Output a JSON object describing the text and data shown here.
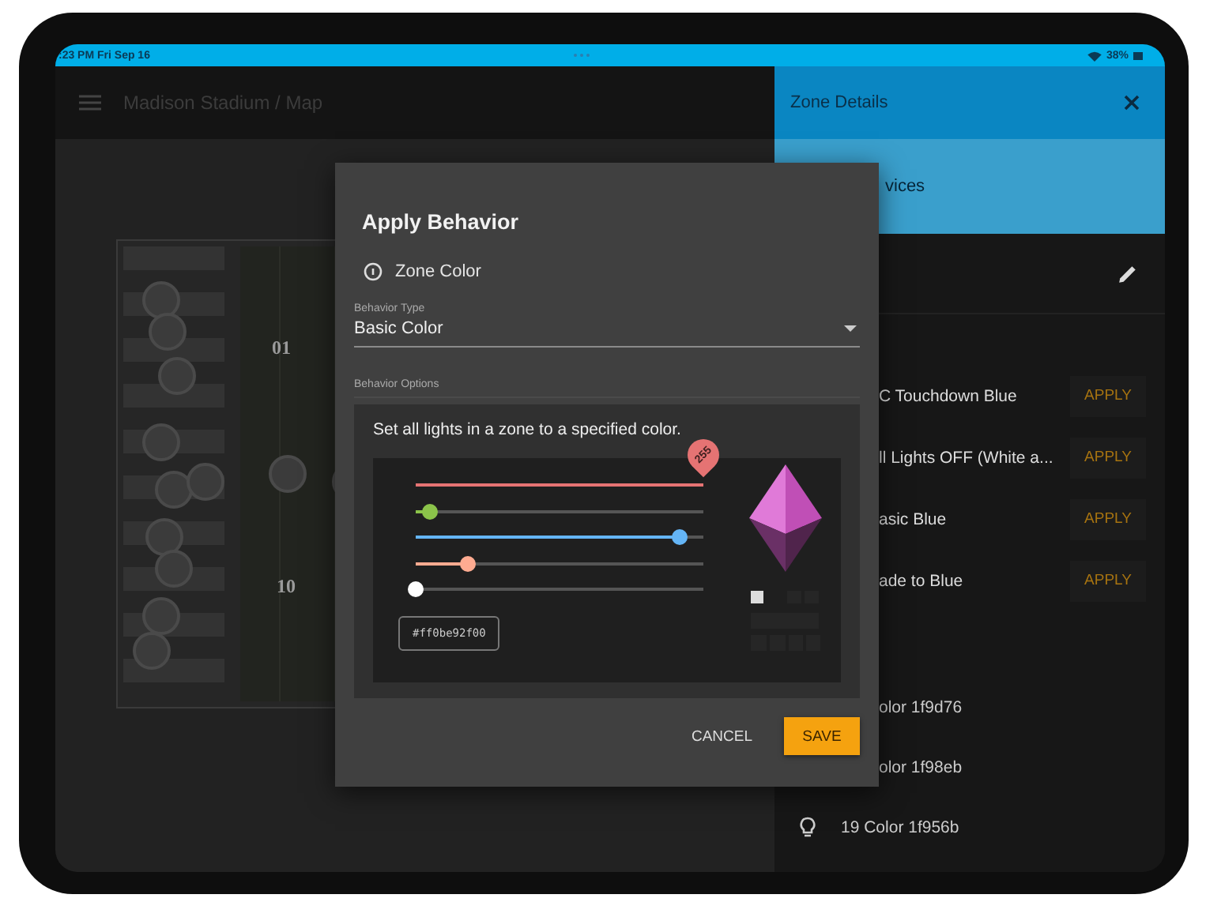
{
  "status_bar": {
    "time": ":23 PM  Fri Sep 16",
    "battery": "38%"
  },
  "app_bar": {
    "title": "Madison Stadium / Map"
  },
  "map": {
    "labels": [
      "01",
      "10"
    ]
  },
  "zone_panel": {
    "title": "Zone Details",
    "tab": "vices",
    "behaviors": [
      {
        "name": "C Touchdown Blue",
        "action": "APPLY"
      },
      {
        "name": "ll Lights OFF (White a...",
        "action": "APPLY"
      },
      {
        "name": "asic Blue",
        "action": "APPLY"
      },
      {
        "name": "ade to Blue",
        "action": "APPLY"
      }
    ],
    "devices": [
      {
        "name": "olor 1f9d76",
        "icon": false
      },
      {
        "name": "olor 1f98eb",
        "icon": false
      },
      {
        "name": "19 Color 1f956b",
        "icon": true
      }
    ]
  },
  "dialog": {
    "title": "Apply Behavior",
    "subtitle": "Zone Color",
    "behavior_type": {
      "label": "Behavior Type",
      "value": "Basic Color"
    },
    "options_label": "Behavior Options",
    "description": "Set all lights in a zone to a specified color.",
    "sliders": [
      {
        "color": "#e57373",
        "level": 1,
        "reading": "255"
      },
      {
        "color": "#8bc34a",
        "level": 0.05
      },
      {
        "color": "#64b5f6",
        "level": 0.92
      },
      {
        "color": "#ffab91",
        "level": 0.18
      },
      {
        "color": "#ffffff",
        "level": 0
      }
    ],
    "hex_value": "#ff0be92f00",
    "buttons": [
      {
        "label": "CANCEL",
        "kind": "text"
      },
      {
        "label": "SAVE",
        "kind": "primary"
      }
    ]
  }
}
